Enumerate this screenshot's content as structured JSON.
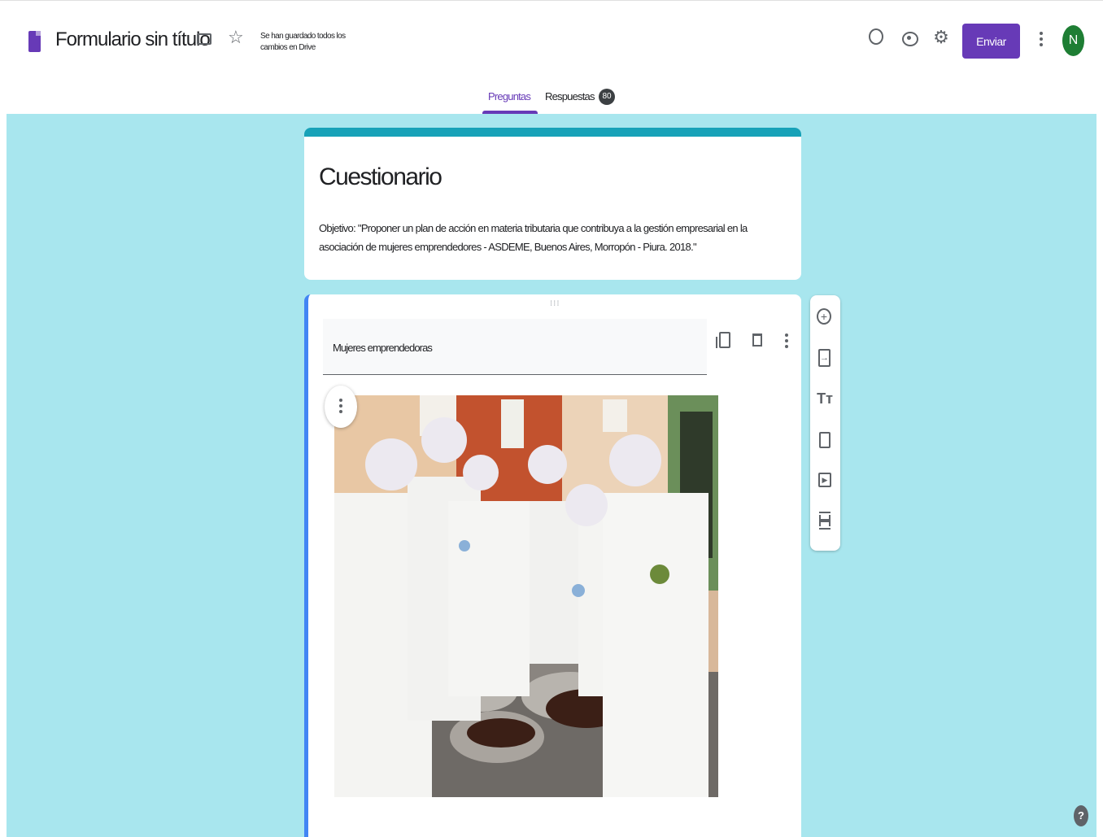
{
  "header": {
    "title": "Formulario sin título",
    "saved_status": "Se han guardado todos los cambios en Drive",
    "send_label": "Enviar",
    "avatar_letter": "N"
  },
  "tabs": {
    "questions_label": "Preguntas",
    "responses_label": "Respuestas",
    "responses_count": "80"
  },
  "form": {
    "heading": "Cuestionario",
    "description": "Objetivo: \"Proponer un plan de acción en materia tributaria que contribuya a la gestión empresarial en la asociación de mujeres emprendedores - ASDEME, Buenos Aires, Morropón - Piura. 2018.\""
  },
  "section": {
    "title": "Mujeres emprendedoras"
  },
  "toolbar": {
    "title_glyph": "Tт",
    "import_glyph": "→",
    "add_glyph": "+",
    "video_glyph": "▶"
  },
  "help_glyph": "?",
  "colors": {
    "accent": "#673ab7",
    "theme_bar": "#17a2b8",
    "background": "#a8e6ee",
    "avatar": "#1e7e34"
  }
}
